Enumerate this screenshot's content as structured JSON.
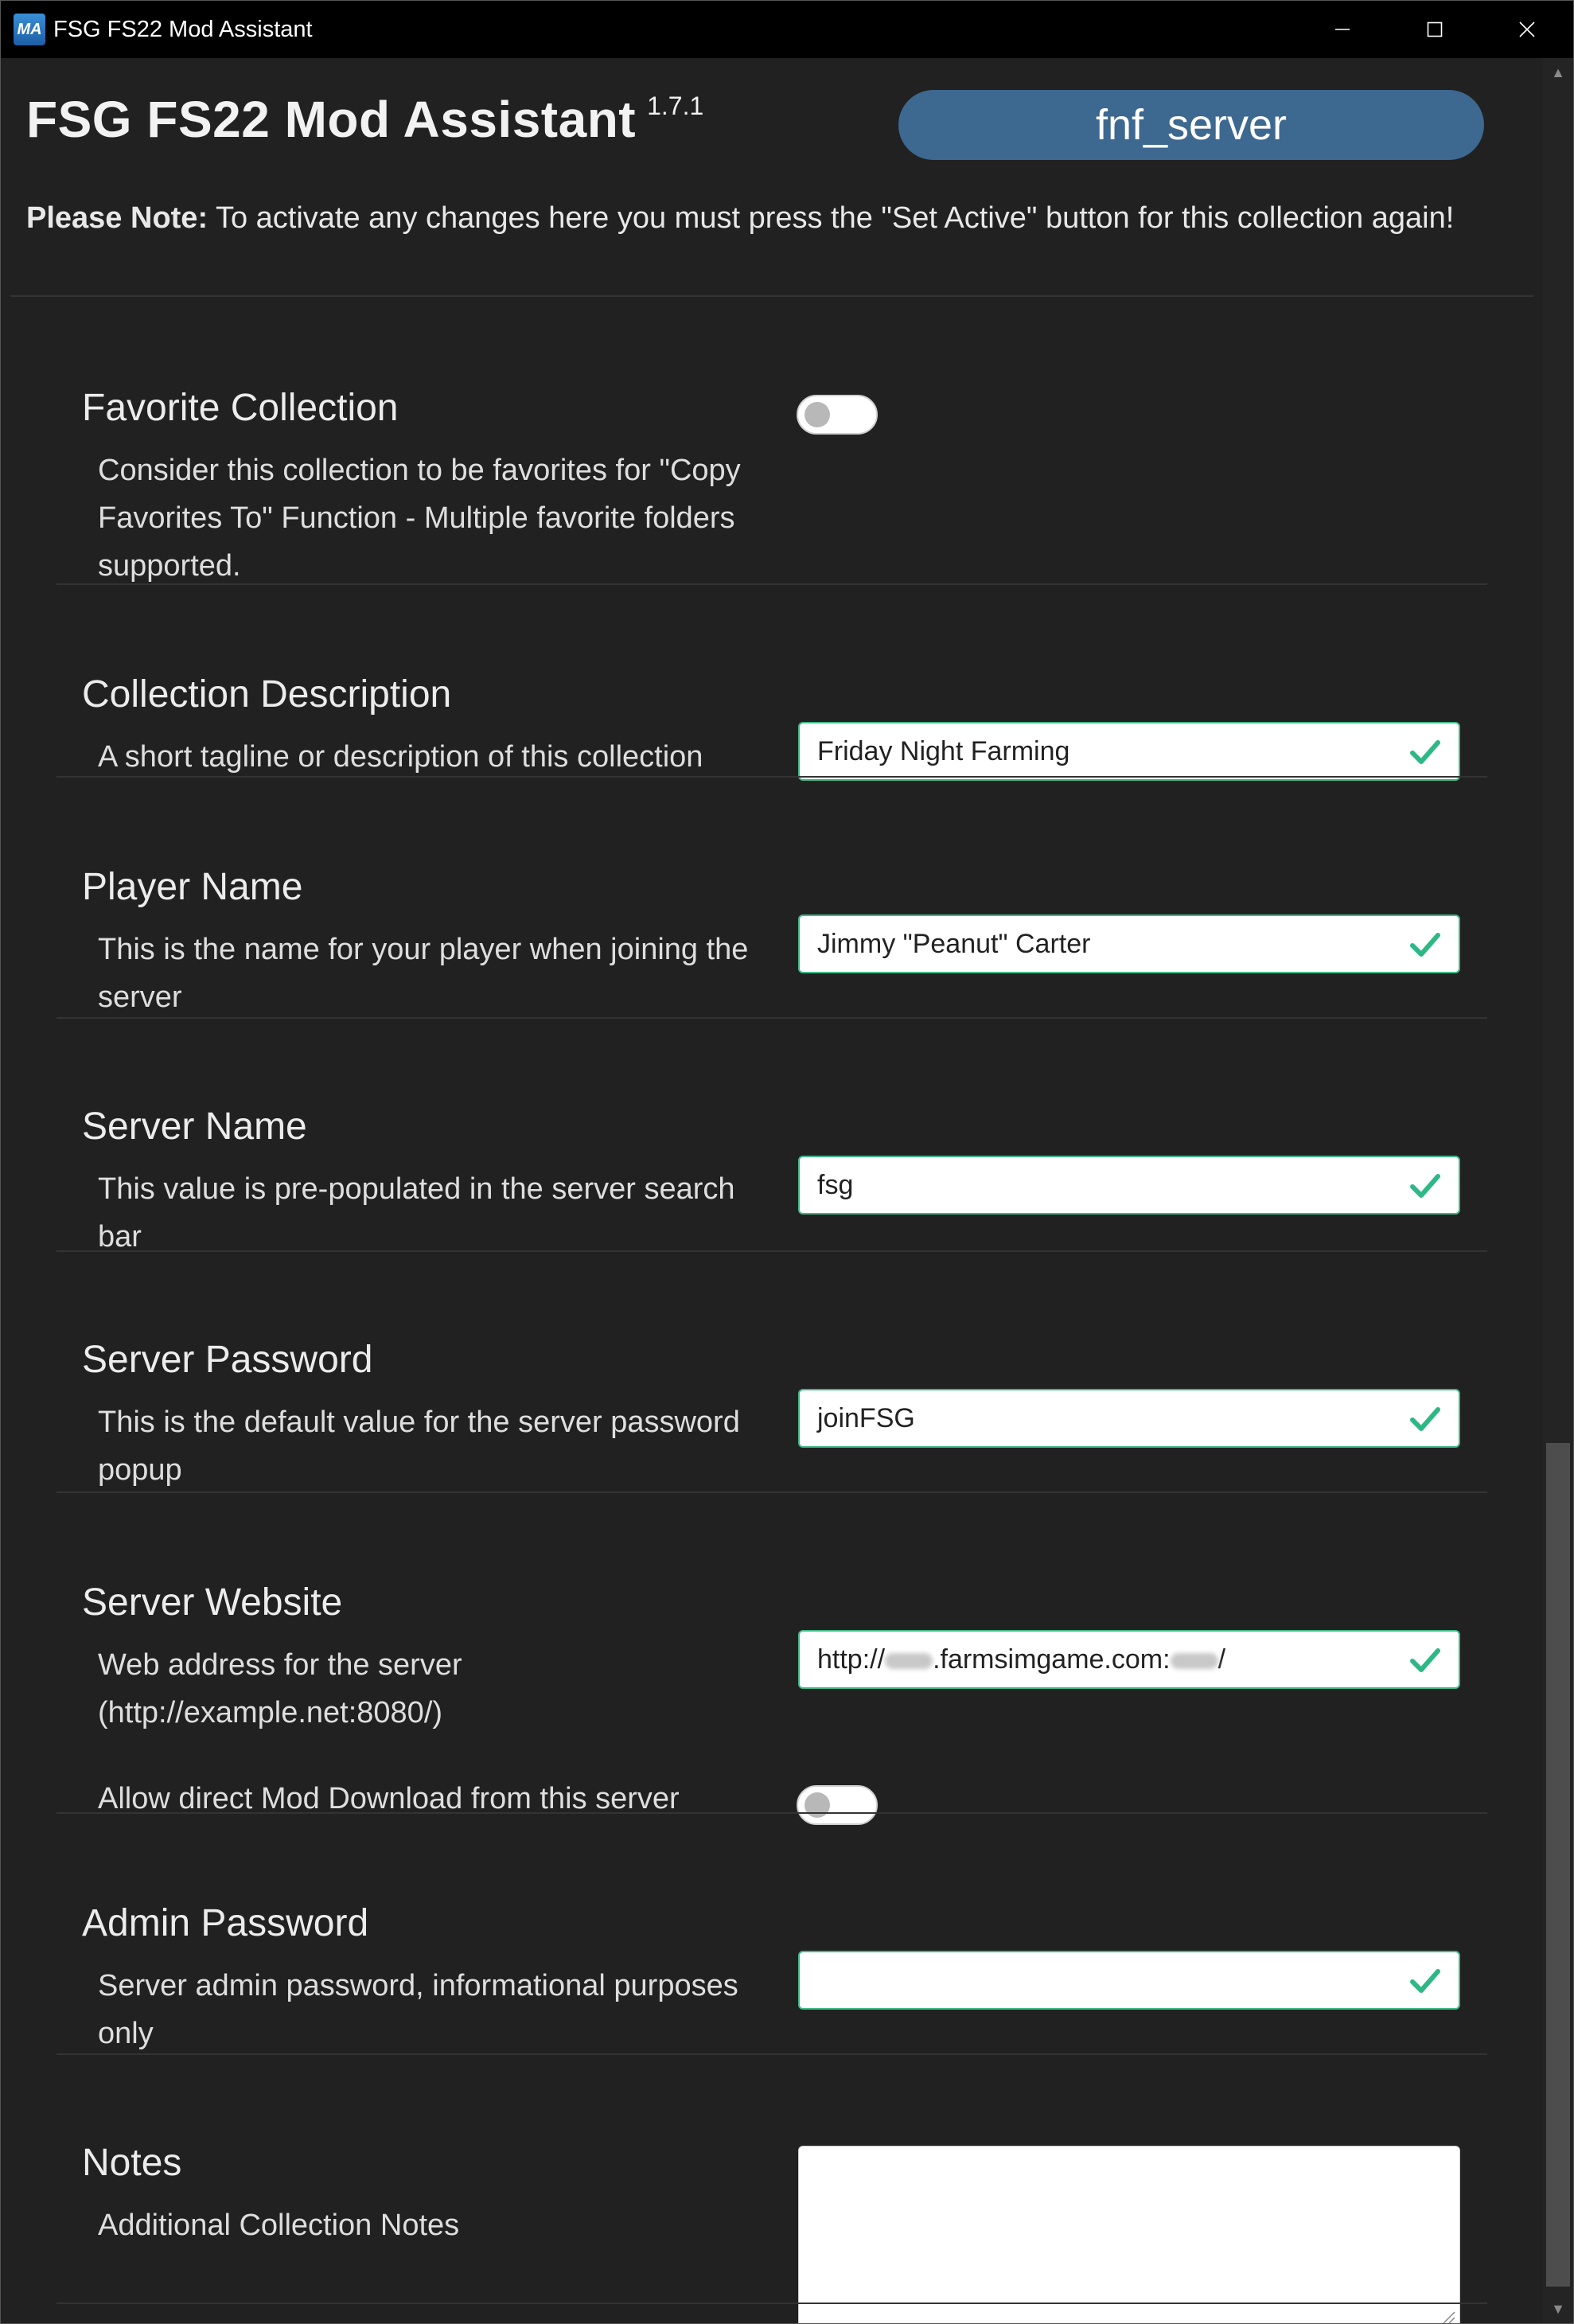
{
  "window": {
    "title": "FSG FS22 Mod Assistant",
    "app_icon_text": "MA"
  },
  "header": {
    "app_title": "FSG FS22 Mod Assistant",
    "version": "1.7.1",
    "collection_name": "fnf_server"
  },
  "note": {
    "label": "Please Note:",
    "text": " To activate any changes here you must press the \"Set Active\" button for this collection again!"
  },
  "sections": {
    "favorite": {
      "title": "Favorite Collection",
      "description": "Consider this collection to be favorites for \"Copy Favorites To\" Function - Multiple favorite folders supported.",
      "enabled": false
    },
    "description": {
      "title": "Collection Description",
      "description": "A short tagline or description of this collection",
      "value": "Friday Night Farming"
    },
    "player_name": {
      "title": "Player Name",
      "description": "This is the name for your player when joining the server",
      "value": "Jimmy \"Peanut\" Carter"
    },
    "server_name": {
      "title": "Server Name",
      "description": "This value is pre-populated in the server search bar",
      "value": "fsg"
    },
    "server_password": {
      "title": "Server Password",
      "description": "This is the default value for the server password popup",
      "value": "joinFSG"
    },
    "server_website": {
      "title": "Server Website",
      "description": "Web address for the server (http://example.net:8080/)",
      "value_prefix": "http://",
      "value_middle": ".farmsimgame.com:",
      "value_suffix": "/",
      "direct_download_label": "Allow direct Mod Download from this server",
      "direct_download_enabled": false
    },
    "admin_password": {
      "title": "Admin Password",
      "description": "Server admin password, informational purposes only",
      "value": ""
    },
    "notes": {
      "title": "Notes",
      "description": "Additional Collection Notes",
      "value": ""
    }
  },
  "colors": {
    "accent_pill": "#3d6890",
    "valid_green": "#2eb886",
    "background": "#212121"
  }
}
